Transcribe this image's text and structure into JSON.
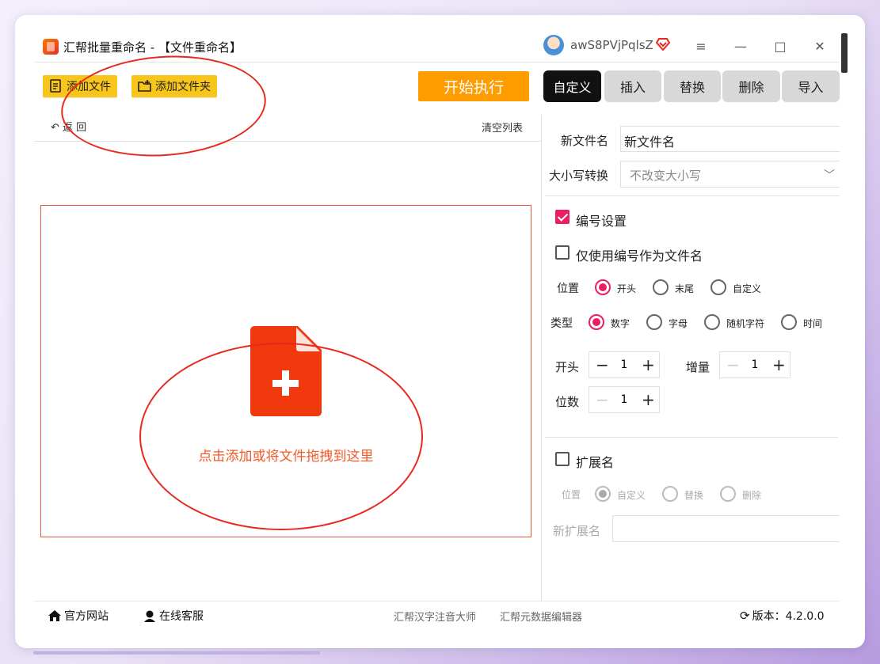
{
  "window": {
    "title": "汇帮批量重命名 - 【文件重命名】",
    "username": "awS8PVjPqlsZ",
    "controls": {
      "menu": "≡",
      "minimize": "—",
      "maximize": "□",
      "close": "✕"
    }
  },
  "toolbar": {
    "add_file": "添加文件",
    "add_folder": "添加文件夹",
    "start": "开始执行",
    "back": "返  回",
    "clear_list": "清空列表"
  },
  "tabs": [
    "自定义",
    "插入",
    "替换",
    "删除",
    "导入"
  ],
  "active_tab": 0,
  "dropzone": {
    "text": "点击添加或将文件拖拽到这里"
  },
  "form": {
    "new_name_label": "新文件名",
    "new_name_value": "新文件名",
    "case_label": "大小写转换",
    "case_value": "不改变大小写",
    "numbering_label": "编号设置",
    "numbering_checked": true,
    "only_number_label": "仅使用编号作为文件名",
    "only_number_checked": false,
    "position_label": "位置",
    "position_options": [
      "开头",
      "末尾",
      "自定义"
    ],
    "position_selected": 0,
    "type_label": "类型",
    "type_options": [
      "数字",
      "字母",
      "随机字符",
      "时间"
    ],
    "type_selected": 0,
    "start_label": "开头",
    "start_value": "1",
    "increment_label": "增量",
    "increment_value": "1",
    "digits_label": "位数",
    "digits_value": "1",
    "extension_label": "扩展名",
    "extension_checked": false,
    "ext_position_label": "位置",
    "ext_position_options": [
      "自定义",
      "替换",
      "删除"
    ],
    "ext_position_selected": 0,
    "new_ext_label": "新扩展名"
  },
  "footer": {
    "website": "官方网站",
    "support": "在线客服",
    "link1": "汇帮汉字注音大师",
    "link2": "汇帮元数据编辑器",
    "version": "版本：4.2.0.0"
  },
  "colors": {
    "accent": "#e91e63",
    "toolbar_button": "#f8c51a",
    "start_button": "#ff9c00",
    "drop_text": "#f05a28",
    "annotation": "#e8281e"
  }
}
